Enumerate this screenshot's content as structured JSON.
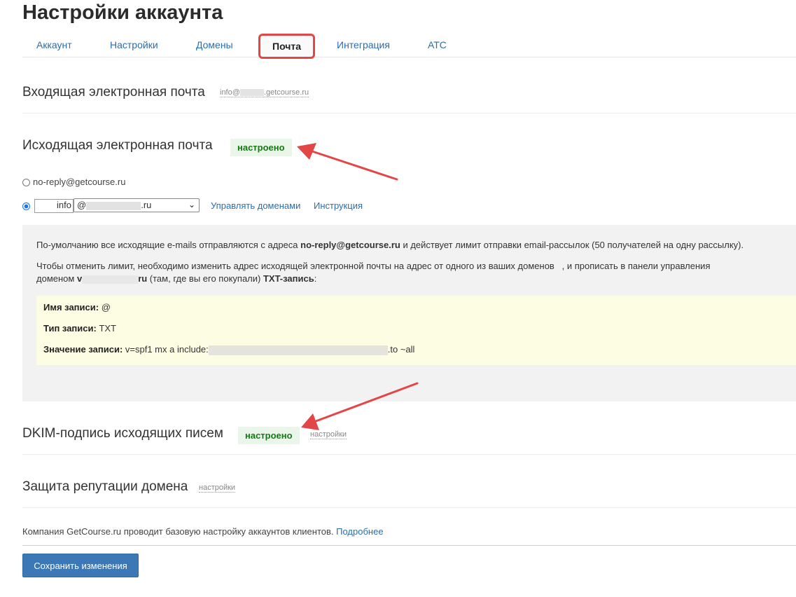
{
  "page": {
    "title": "Настройки аккаунта"
  },
  "tabs": [
    {
      "label": "Аккаунт"
    },
    {
      "label": "Настройки"
    },
    {
      "label": "Домены"
    },
    {
      "label": "Почта"
    },
    {
      "label": "Интеграция"
    },
    {
      "label": "АТС"
    }
  ],
  "incoming": {
    "title": "Входящая электронная почта",
    "email_prefix": "info@",
    "email_suffix": ".getcourse.ru"
  },
  "outgoing": {
    "title": "Исходящая электронная почта",
    "status": "настроено",
    "option_default": "no-reply@getcourse.ru",
    "local_part": "info",
    "domain_prefix": "@",
    "domain_suffix": ".ru",
    "manage_domains_link": "Управлять доменами",
    "instructions_link": "Инструкция"
  },
  "info": {
    "p1_a": "По-умолчанию все исходящие e-mails отправляются с адреса ",
    "p1_b": "no-reply@getcourse.ru",
    "p1_c": " и действует лимит отправки email-рассылок (50 получателей на одну рассылку).",
    "p2_a": "Чтобы отменить лимит, необходимо изменить адрес исходящей электронной почты на адрес от одного из ваших доменов",
    "p2_b": ", и прописать в панели управления",
    "p2_c": "доменом ",
    "p2_d": "v",
    "p2_e": "ru",
    "p2_f": " (там, где вы его покупали) ",
    "p2_g": "TXT-запись",
    "p2_h": ":"
  },
  "record": {
    "name_label": "Имя записи:",
    "name_value": " @",
    "type_label": "Тип записи:",
    "type_value": " TXT",
    "value_label": "Значение записи:",
    "value_prefix": " v=spf1 mx a include:",
    "value_suffix": ".to ~all"
  },
  "dkim": {
    "title": "DKIM-подпись исходящих писем",
    "status": "настроено",
    "settings_link": "настройки"
  },
  "reputation": {
    "title": "Защита репутации домена",
    "settings_link": "настройки"
  },
  "footer": {
    "text": "Компания GetCourse.ru проводит базовую настройку аккаунтов клиентов. ",
    "more_link": "Подробнее"
  },
  "save_button": {
    "label": "Сохранить изменения"
  },
  "colors": {
    "link": "#2a6db0",
    "status_green": "#137a13",
    "status_bg": "#eaf6ea",
    "highlight_red": "#e34646",
    "primary_button": "#3b78b5"
  }
}
